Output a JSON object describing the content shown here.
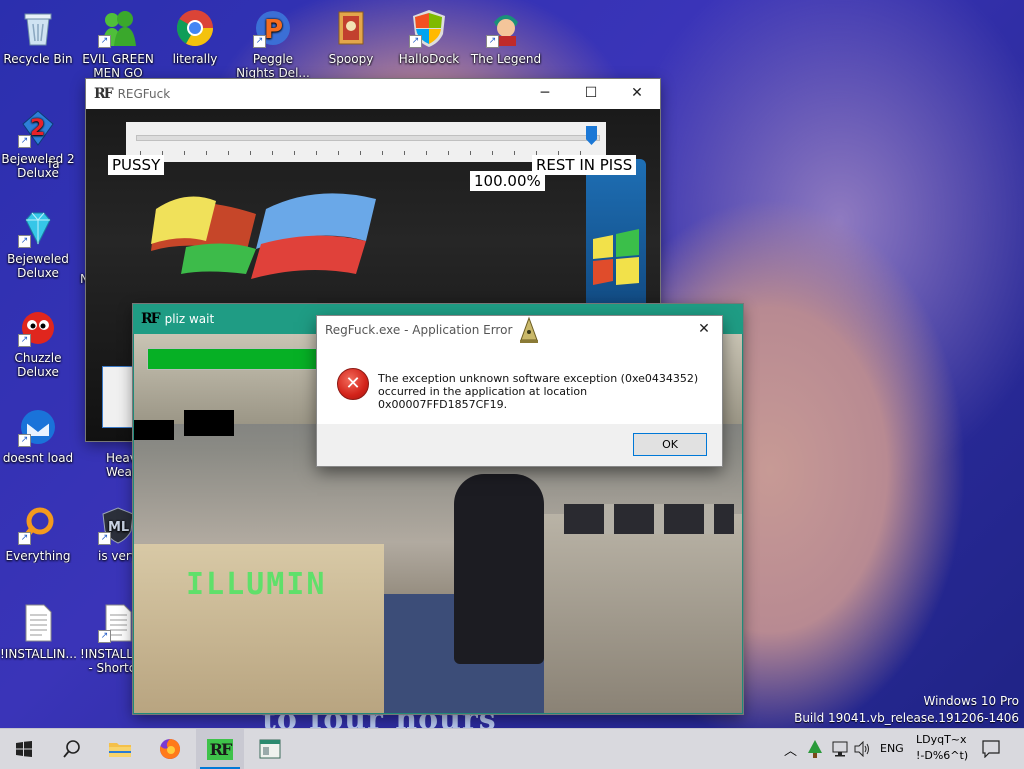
{
  "desktop": {
    "icons": [
      {
        "name": "recycle-bin",
        "label": "Recycle Bin"
      },
      {
        "name": "evil-green-men",
        "label": "EVIL GREEN MEN GO"
      },
      {
        "name": "literally",
        "label": "literally"
      },
      {
        "name": "peggle-nights",
        "label": "Peggle Nights Del..."
      },
      {
        "name": "spoopy",
        "label": "Spoopy"
      },
      {
        "name": "hallodock",
        "label": "HalloDock"
      },
      {
        "name": "the-legend",
        "label": "The Legend"
      },
      {
        "name": "bejeweled-2",
        "label": "Bejeweled 2 Deluxe"
      },
      {
        "name": "bejeweled",
        "label": "Bejeweled Deluxe"
      },
      {
        "name": "chuzzle",
        "label": "Chuzzle Deluxe"
      },
      {
        "name": "doesnt-load",
        "label": "doesnt load"
      },
      {
        "name": "everything",
        "label": "Everything"
      },
      {
        "name": "installing-1",
        "label": "!INSTALLIN..."
      },
      {
        "name": "heavy-weapon",
        "label": "Heavy Weap..."
      },
      {
        "name": "is-very",
        "label": "is very"
      },
      {
        "name": "installing-2",
        "label": "!INSTALLIN... - Shortcut"
      }
    ],
    "partial_label_fa": "fa",
    "partial_label_n": "N"
  },
  "regfuck_window": {
    "title": "REGFuck",
    "logo": "RF",
    "slider_left_label": "PUSSY",
    "slider_right_label": "REST IN PISS",
    "slider_value": "100.00%",
    "slider_fraction": 1.0
  },
  "pliz_window": {
    "title": "pliz wait",
    "logo": "RF",
    "progress_fraction": 0.65,
    "overlay_text": "ILLUMIN"
  },
  "error_dialog": {
    "title": "RegFuck.exe - Application Error",
    "message_line1": "The exception unknown software exception (0xe0434352)",
    "message_line2": "occurred in the application at location 0x00007FFD1857CF19.",
    "ok_label": "OK"
  },
  "watermark": {
    "line1": "Windows 10 Pro",
    "line2": "Build 19041.vb_release.191206-1406"
  },
  "background_caption": "to four hours",
  "taskbar": {
    "language": "ENG",
    "clock_line1": "LDyqT~x",
    "clock_line2": "!-D%6^t)",
    "active_app_logo": "RF"
  },
  "colors": {
    "taskbar_bg": "#d9d9de",
    "pliz_titlebar": "#1f9c84",
    "progress_fill": "#06b025",
    "accent": "#0078d7"
  }
}
